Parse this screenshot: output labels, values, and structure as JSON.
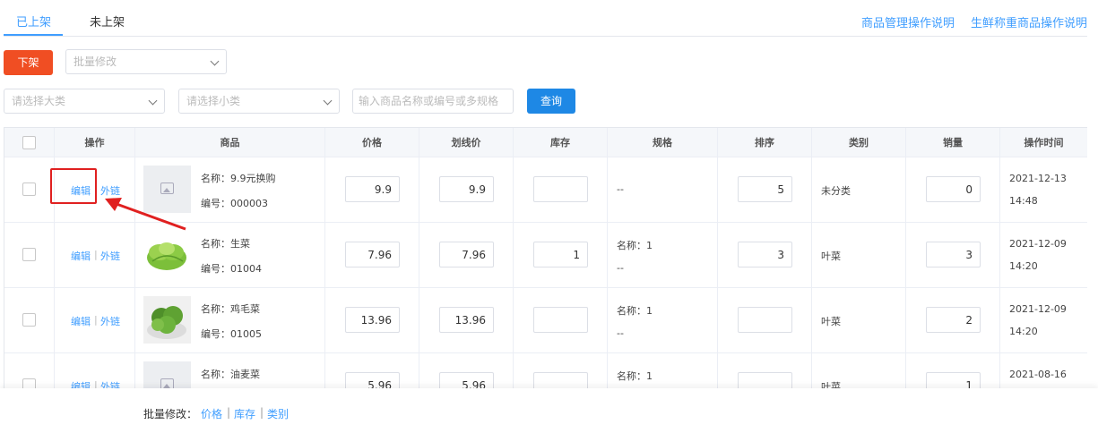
{
  "tabs": [
    {
      "label": "已上架",
      "active": true
    },
    {
      "label": "未上架",
      "active": false
    }
  ],
  "help_links": [
    "商品管理操作说明",
    "生鲜称重商品操作说明"
  ],
  "toolbar": {
    "off_shelf_label": "下架",
    "batch_edit_placeholder": "批量修改",
    "category_major_placeholder": "请选择大类",
    "category_minor_placeholder": "请选择小类",
    "search_placeholder": "输入商品名称或编号或多规格",
    "query_label": "查询"
  },
  "table": {
    "headers": [
      "操作",
      "商品",
      "价格",
      "划线价",
      "库存",
      "规格",
      "排序",
      "类别",
      "销量",
      "操作时间"
    ],
    "edit_label": "编辑",
    "sep": "|",
    "link_label": "外链",
    "rows": [
      {
        "name": "名称：9.9元换购",
        "code": "编号：000003",
        "image": "placeholder-image",
        "price": "9.9",
        "strike_price": "9.9",
        "stock": "",
        "spec1": "--",
        "spec2": "",
        "sort": "5",
        "category": "未分类",
        "sales": "0",
        "date": "2021-12-13",
        "time": "14:48"
      },
      {
        "name": "名称：生菜",
        "code": "编号：01004",
        "image": "lettuce-photo",
        "price": "7.96",
        "strike_price": "7.96",
        "stock": "1",
        "spec1": "名称：1",
        "spec2": "--",
        "sort": "3",
        "category": "叶菜",
        "sales": "3",
        "date": "2021-12-09",
        "time": "14:20"
      },
      {
        "name": "名称：鸡毛菜",
        "code": "编号：01005",
        "image": "greens-photo",
        "price": "13.96",
        "strike_price": "13.96",
        "stock": "",
        "spec1": "名称：1",
        "spec2": "--",
        "sort": "",
        "category": "叶菜",
        "sales": "2",
        "date": "2021-12-09",
        "time": "14:20"
      },
      {
        "name": "名称：油麦菜",
        "code": "",
        "image": "placeholder-image",
        "price": "5.96",
        "strike_price": "5.96",
        "stock": "",
        "spec1": "名称：1",
        "spec2": "",
        "sort": "",
        "category": "叶菜",
        "sales": "1",
        "date": "2021-08-16",
        "time": ""
      }
    ]
  },
  "footer": {
    "batch_label": "批量修改：",
    "links": [
      "价格",
      "库存",
      "类别"
    ],
    "sep": "|"
  },
  "colors": {
    "accent": "#409eff",
    "danger_button": "#f04e23",
    "query_button": "#1e88e5",
    "annotation_red": "#e02020"
  }
}
